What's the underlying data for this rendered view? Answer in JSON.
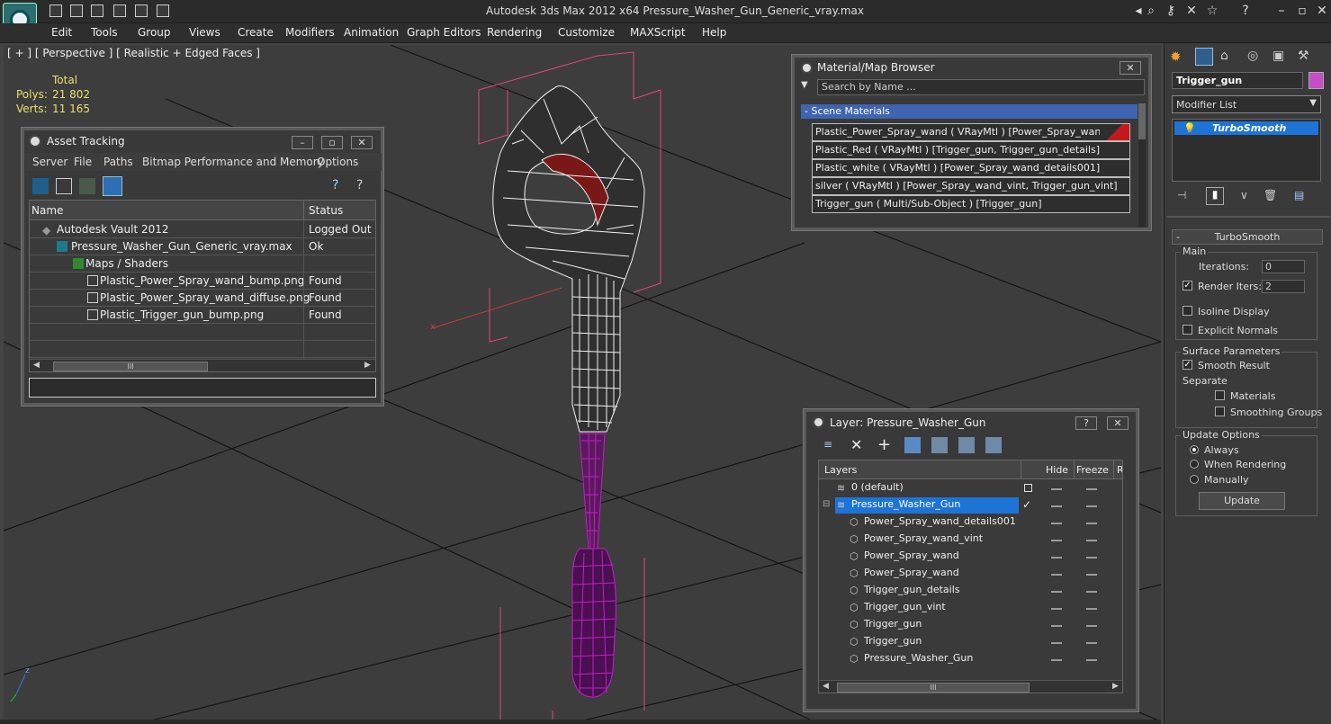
{
  "app": {
    "title": "Autodesk 3ds Max  2012 x64     Pressure_Washer_Gun_Generic_vray.max"
  },
  "menu": [
    "Edit",
    "Tools",
    "Group",
    "Views",
    "Create",
    "Modifiers",
    "Animation",
    "Graph Editors",
    "Rendering",
    "Customize",
    "MAXScript",
    "Help"
  ],
  "viewport": {
    "label": "[ + ] [ Perspective ] [ Realistic + Edged Faces ]",
    "stats": {
      "header": "Total",
      "polys_label": "Polys:",
      "polys": "21 802",
      "verts_label": "Verts:",
      "verts": "11 165"
    },
    "axis": {
      "x": "x",
      "y": "y",
      "z": "z"
    }
  },
  "asset_tracking": {
    "title": "Asset Tracking",
    "menu": [
      "Server",
      "File",
      "Paths",
      "Bitmap Performance and Memory",
      "Options"
    ],
    "columns": {
      "name": "Name",
      "status": "Status"
    },
    "rows": [
      {
        "name": "Autodesk Vault 2012",
        "status": "Logged Out (A"
      },
      {
        "name": "Pressure_Washer_Gun_Generic_vray.max",
        "status": "Ok"
      },
      {
        "name": "Maps / Shaders",
        "status": ""
      },
      {
        "name": "Plastic_Power_Spray_wand_bump.png",
        "status": "Found"
      },
      {
        "name": "Plastic_Power_Spray_wand_diffuse.png",
        "status": "Found"
      },
      {
        "name": "Plastic_Trigger_gun_bump.png",
        "status": "Found"
      }
    ],
    "scroll_grip": "III"
  },
  "material_browser": {
    "title": "Material/Map Browser",
    "search_placeholder": "Search by Name ...",
    "section": "- Scene Materials",
    "items": [
      "Plastic_Power_Spray_wand  ( VRayMtl ) [Power_Spray_wand]",
      "Plastic_Red  ( VRayMtl ) [Trigger_gun, Trigger_gun_details]",
      "Plastic_white  ( VRayMtl ) [Power_Spray_wand_details001]",
      "silver  ( VRayMtl ) [Power_Spray_wand_vint, Trigger_gun_vint]",
      "Trigger_gun  ( Multi/Sub-Object ) [Trigger_gun]"
    ]
  },
  "layer_dialog": {
    "title": "Layer: Pressure_Washer_Gun",
    "help": "?",
    "columns": {
      "layers": "Layers",
      "hide": "Hide",
      "freeze": "Freeze",
      "render": "R"
    },
    "rows": [
      {
        "name": "0 (default)",
        "level": 0,
        "selected": false
      },
      {
        "name": "Pressure_Washer_Gun",
        "level": 0,
        "selected": true
      },
      {
        "name": "Power_Spray_wand_details001",
        "level": 1,
        "selected": false
      },
      {
        "name": "Power_Spray_wand_vint",
        "level": 1,
        "selected": false
      },
      {
        "name": "Power_Spray_wand",
        "level": 1,
        "selected": false
      },
      {
        "name": "Power_Spray_wand",
        "level": 1,
        "selected": false
      },
      {
        "name": "Trigger_gun_details",
        "level": 1,
        "selected": false
      },
      {
        "name": "Trigger_gun_vint",
        "level": 1,
        "selected": false
      },
      {
        "name": "Trigger_gun",
        "level": 1,
        "selected": false
      },
      {
        "name": "Trigger_gun",
        "level": 1,
        "selected": false
      },
      {
        "name": "Pressure_Washer_Gun",
        "level": 1,
        "selected": false
      }
    ],
    "scroll_grip": "III"
  },
  "command_panel": {
    "object_name": "Trigger_gun",
    "object_color": "#c24fc7",
    "modifier_list": "Modifier List",
    "stack_item": "TurboSmooth",
    "rollout_title": "TurboSmooth",
    "main": {
      "label": "Main",
      "iterations_label": "Iterations:",
      "iterations": "0",
      "render_iters_label": "Render Iters:",
      "render_iters": "2",
      "render_iters_checked": true,
      "isoline_label": "Isoline Display",
      "isoline_checked": false,
      "explicit_label": "Explicit Normals",
      "explicit_checked": false
    },
    "surface": {
      "label": "Surface Parameters",
      "smooth_label": "Smooth Result",
      "smooth_checked": true,
      "separate_label": "Separate",
      "materials_label": "Materials",
      "materials_checked": false,
      "groups_label": "Smoothing Groups",
      "groups_checked": false
    },
    "update": {
      "label": "Update Options",
      "always": "Always",
      "when_rendering": "When Rendering",
      "manually": "Manually",
      "selected": "Always",
      "button": "Update"
    }
  },
  "colors": {
    "wire_white": "#f2f2f2",
    "wire_magenta": "#c020c8",
    "bbox_pink": "#e0457a",
    "selection_blue": "#1e74d6",
    "stat_yellow": "#e8e06a"
  }
}
